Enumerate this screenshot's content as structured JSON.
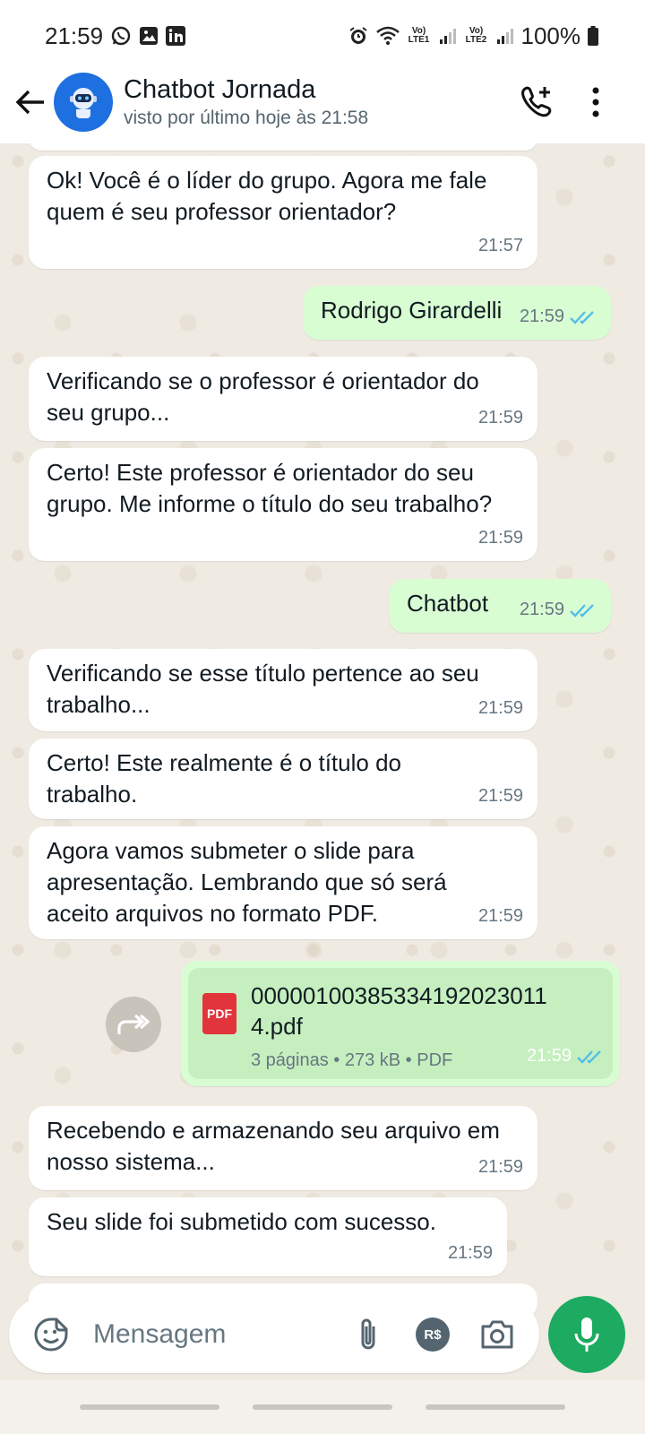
{
  "status_bar": {
    "time": "21:59",
    "lte1": "Vo) LTE1",
    "lte2": "Vo) LTE2",
    "battery": "100%"
  },
  "header": {
    "title": "Chatbot Jornada",
    "subtitle": "visto por último hoje às 21:58"
  },
  "messages": [
    {
      "text": "Ok! Você é o líder do grupo. Agora me fale quem é seu professor orientador?",
      "time": "21:57",
      "direction": "in"
    },
    {
      "text": "Rodrigo Girardelli",
      "time": "21:59",
      "direction": "out",
      "status": "read"
    },
    {
      "text": "Verificando se o professor é orientador do seu grupo...",
      "time": "21:59",
      "direction": "in"
    },
    {
      "text": "Certo! Este professor é orientador do seu grupo. Me informe o título do seu trabalho?",
      "time": "21:59",
      "direction": "in"
    },
    {
      "text": "Chatbot",
      "time": "21:59",
      "direction": "out",
      "status": "read"
    },
    {
      "text": "Verificando se esse título pertence ao seu trabalho...",
      "time": "21:59",
      "direction": "in"
    },
    {
      "text": "Certo! Este realmente é o título do trabalho.",
      "time": "21:59",
      "direction": "in"
    },
    {
      "text": "Agora vamos submeter o slide para apresentação. Lembrando que só será aceito arquivos no formato PDF.",
      "time": "21:59",
      "direction": "in"
    },
    {
      "text": "Recebendo e armazenando seu arquivo em nosso sistema...",
      "time": "21:59",
      "direction": "in"
    },
    {
      "text": "Seu slide foi submetido com sucesso.",
      "time": "21:59",
      "direction": "in"
    }
  ],
  "file_message": {
    "name": "00000100385334192023011 4.pdf",
    "name_line1": "00000100385334192023011",
    "name_line2": "4.pdf",
    "meta": "3 páginas • 273 kB • PDF",
    "badge": "PDF",
    "time": "21:59"
  },
  "composer": {
    "placeholder": "Mensagem",
    "payment_label": "R$"
  },
  "colors": {
    "incoming": "#ffffff",
    "outgoing": "#d9fdd3",
    "accent": "#1daa61",
    "read_tick": "#53bdeb",
    "pdf_red": "#e2343b"
  }
}
